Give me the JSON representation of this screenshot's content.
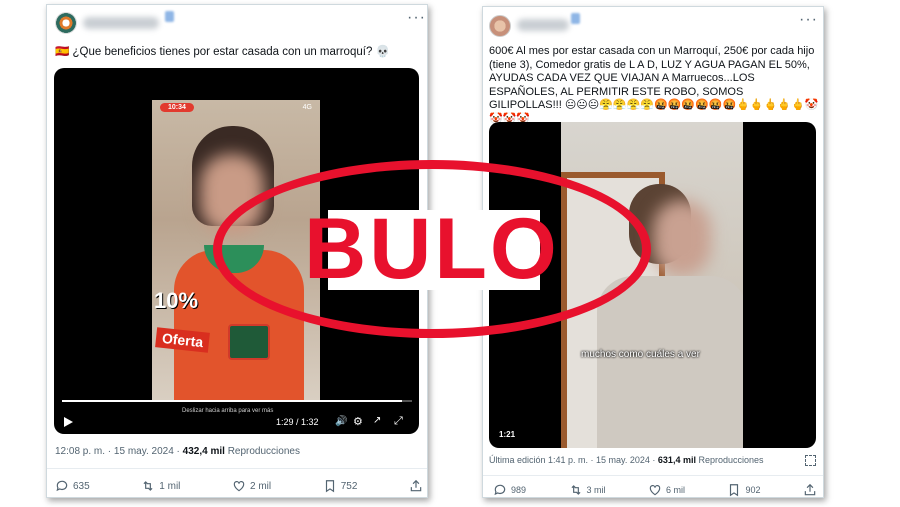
{
  "left_tweet": {
    "flag": "🇪🇸",
    "text": "¿Que beneficios tienes por estar casada con un marroquí? 💀",
    "video": {
      "phone_time": "10:34",
      "phone_signal": "4G",
      "offer_percent": "10%",
      "offer_label": "Oferta",
      "swipe_hint": "Deslizar hacia arriba para ver más",
      "timecode": "1:29 / 1:32"
    },
    "meta": {
      "time": "12:08 p. m. · 15 may. 2024 · ",
      "views": "432,4 mil",
      "views_label": " Reproducciones"
    },
    "actions": {
      "replies": "635",
      "reposts": "1 mil",
      "likes": "2 mil",
      "bookmarks": "752"
    }
  },
  "right_tweet": {
    "text": "600€ Al mes por estar casada con un Marroquí, 250€ por cada hijo (tiene 3), Comedor gratis de L A D, LUZ Y AGUA PAGAN EL 50%, AYUDAS CADA VEZ QUE VIAJAN A Marruecos...LOS ESPAÑOLES, AL PERMITIR ESTE ROBO, SOMOS GILIPOLLAS!!! 😐😐😐😤😤😤😤🤬🤬🤬🤬🤬🤬🖕🖕🖕🖕🖕🤡🤡🤡🤡",
    "video": {
      "caption": "muchos como cuáles a ver",
      "duration": "1:21"
    },
    "meta": {
      "time": "Última edición 1:41 p. m. · 15 may. 2024 · ",
      "views": "631,4 mil",
      "views_label": " Reproducciones"
    },
    "actions": {
      "replies": "989",
      "reposts": "3 mil",
      "likes": "6 mil",
      "bookmarks": "902"
    }
  },
  "stamp": {
    "text": "BULO",
    "color": "#e8112d"
  },
  "colors": {
    "secondary_text": "#536471",
    "border": "#cfd9de"
  }
}
